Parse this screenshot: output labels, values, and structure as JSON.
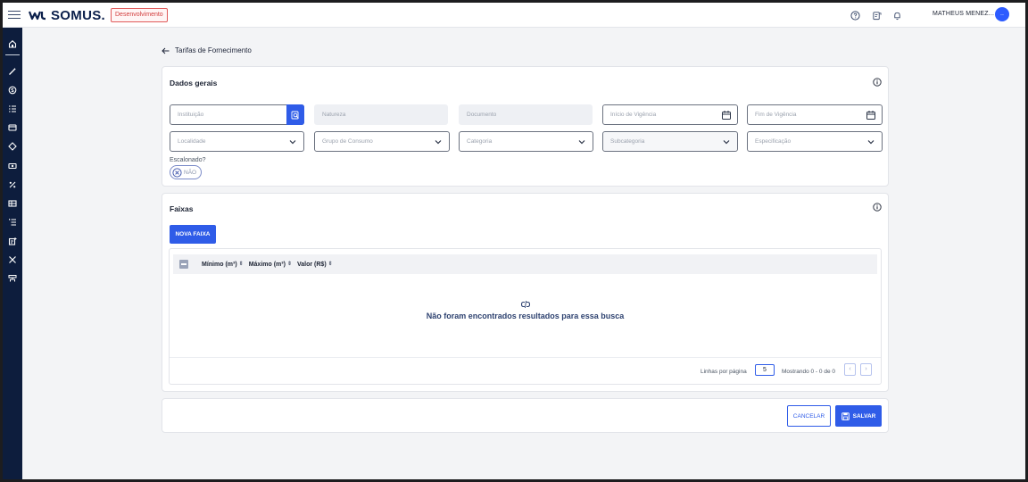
{
  "topbar": {
    "logo_text": "SOMUS.",
    "env_badge": "Desenvolvimento",
    "user_name": "MATHEUS MENEZ...",
    "avatar_initial": "..",
    "accent_color": "#2f5ce8"
  },
  "sidebar": {
    "icons": [
      "home-icon",
      "magic-wand-icon",
      "dollar-cycle-icon",
      "list-icon",
      "credit-card-icon",
      "diamond-icon",
      "cash-icon",
      "percent-icon",
      "table-icon",
      "ordered-list-icon",
      "receipt-icon",
      "tools-icon",
      "network-icon"
    ]
  },
  "breadcrumb": {
    "title": "Tarifas de Fornecimento"
  },
  "dados_gerais": {
    "title": "Dados gerais",
    "fields": {
      "instituicao": "Instituição",
      "natureza": "Natureza",
      "documento": "Documento",
      "inicio_vigencia": "Início de Vigência",
      "fim_vigencia": "Fim de Vigência",
      "localidade": "Localidade",
      "grupo_consumo": "Grupo de Consumo",
      "categoria": "Categoria",
      "subcategoria": "Subcategoria",
      "especificacao": "Especificação"
    },
    "escalonado_label": "Escalonado?",
    "escalonado_value": "NÃO"
  },
  "faixas": {
    "title": "Faixas",
    "new_button": "NOVA FAIXA",
    "columns": [
      "Mínimo (m³)",
      "Máximo (m³)",
      "Valor (R$)"
    ],
    "empty_message": "Não foram encontrados resultados para essa busca",
    "rows_per_page_label": "Linhas por página",
    "rows_per_page_value": "5",
    "showing_text": "Mostrando 0 - 0 de 0",
    "prev_symbol": "‹",
    "next_symbol": "›"
  },
  "actions": {
    "cancel_label": "CANCELAR",
    "save_label": "SALVAR"
  }
}
